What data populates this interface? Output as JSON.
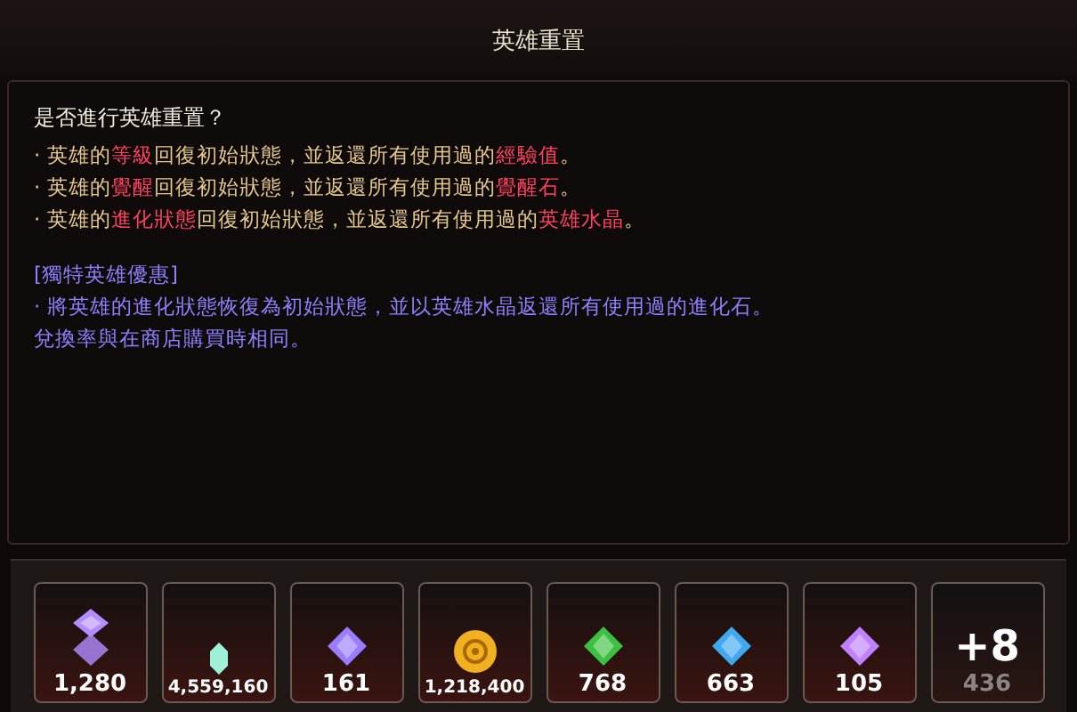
{
  "window": {
    "title": "英雄重置"
  },
  "question": "是否進行英雄重置？",
  "reset_lines": [
    [
      {
        "text": "· 英雄的",
        "highlight": false
      },
      {
        "text": "等級",
        "highlight": true
      },
      {
        "text": "回復初始狀態，並返還所有使用過的",
        "highlight": false
      },
      {
        "text": "經驗值",
        "highlight": true
      },
      {
        "text": "。",
        "highlight": false
      }
    ],
    [
      {
        "text": "· 英雄的",
        "highlight": false
      },
      {
        "text": "覺醒",
        "highlight": true
      },
      {
        "text": "回復初始狀態，並返還所有使用過的",
        "highlight": false
      },
      {
        "text": "覺醒石",
        "highlight": true
      },
      {
        "text": "。",
        "highlight": false
      }
    ],
    [
      {
        "text": "· 英雄的",
        "highlight": false
      },
      {
        "text": "進化狀態",
        "highlight": true
      },
      {
        "text": "回復初始狀態，並返還所有使用過的",
        "highlight": false
      },
      {
        "text": "英雄水晶",
        "highlight": true
      },
      {
        "text": "。",
        "highlight": false
      }
    ]
  ],
  "offer": {
    "heading": "[獨特英雄優惠]",
    "lines": [
      "· 將英雄的進化狀態恢復為初始狀態，並以英雄水晶返還所有使用過的進化石。",
      "兌換率與在商店購買時相同。"
    ]
  },
  "rewards": [
    {
      "kind": "stone",
      "color": "#b48cff",
      "count": "1,280"
    },
    {
      "kind": "shard",
      "color": "#9ff0d8",
      "count": "4,559,160"
    },
    {
      "kind": "gem",
      "color": "#9a7cff",
      "count": "161"
    },
    {
      "kind": "coin",
      "color": "#f0b020",
      "count": "1,218,400"
    },
    {
      "kind": "gem",
      "color": "#3cc040",
      "count": "768"
    },
    {
      "kind": "gem",
      "color": "#40a8f0",
      "count": "663"
    },
    {
      "kind": "gem",
      "color": "#c080ff",
      "count": "105"
    },
    {
      "kind": "more",
      "label": "+8",
      "count": "436"
    }
  ]
}
